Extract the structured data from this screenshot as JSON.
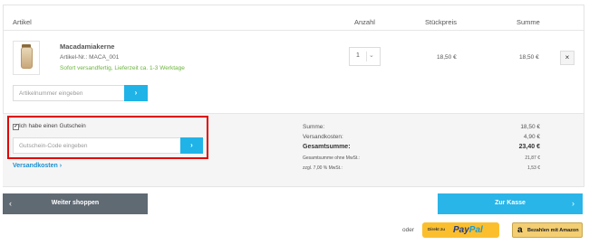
{
  "header": {
    "artikel": "Artikel",
    "anzahl": "Anzahl",
    "stueckpreis": "Stückpreis",
    "summe": "Summe"
  },
  "item": {
    "name": "Macadamiakerne",
    "sku": "Artikel-Nr.: MACA_001",
    "availability": "Sofort versandfertig, Lieferzeit ca. 1-3 Werktage",
    "quantity": "1",
    "unit_price": "18,50 €",
    "total": "18,50 €",
    "remove": "×"
  },
  "article_input": {
    "placeholder": "Artikelnummer eingeben",
    "button": "›"
  },
  "voucher": {
    "checkbox_label": "Ich habe einen Gutschein",
    "checkmark": "✔",
    "placeholder": "Gutschein-Code eingeben",
    "button": "›"
  },
  "shipping_link": "Versandkosten ›",
  "totals": {
    "rows": [
      {
        "label": "Summe:",
        "value": "18,50 €"
      },
      {
        "label": "Versandkosten:",
        "value": "4,90 €"
      },
      {
        "label": "Gesamtsumme:",
        "value": "23,40 €"
      },
      {
        "label": "Gesamtsumme ohne MwSt.:",
        "value": "21,87 €"
      },
      {
        "label": "zzgl. 7,00 % MwSt.:",
        "value": "1,53 €"
      }
    ]
  },
  "buttons": {
    "continue_shopping": "Weiter shoppen",
    "continue_arrow": "‹",
    "checkout": "Zur Kasse",
    "checkout_arrow": "›"
  },
  "payment": {
    "oder": "oder",
    "paypal_prefix": "Direkt zu",
    "paypal_pay": "Pay",
    "paypal_pal": "Pal",
    "amazon_a": "a",
    "amazon_label": "Bezahlen mit Amazon"
  },
  "colors": {
    "accent": "#1fb3e8",
    "highlight_border": "#e00000",
    "green": "#6db33f",
    "dark_button": "#5f6a73"
  }
}
